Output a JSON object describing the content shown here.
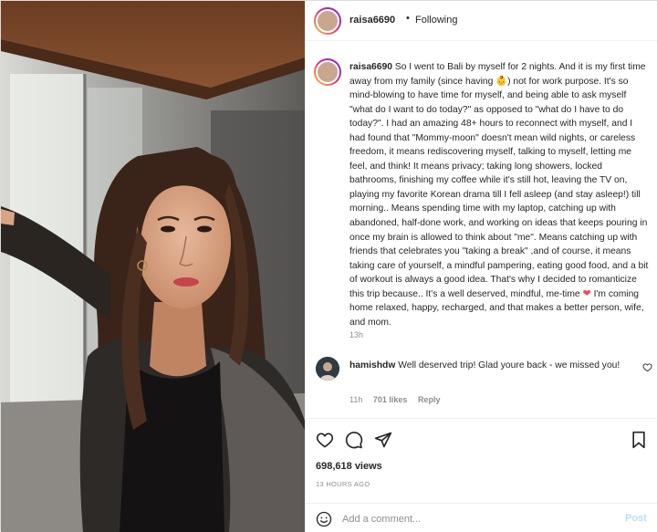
{
  "header": {
    "username": "raisa6690",
    "separator": "•",
    "follow_status": "Following"
  },
  "caption": {
    "username": "raisa6690",
    "text_part1": "So I went to Bali by myself for 2 nights. And it is my first time away from my family (since having ",
    "emoji_baby": "👶",
    "text_part2": ") not for work purpose. It's so mind-blowing to have time for myself, and being able to ask myself \"what do I want to do today?\" as opposed to \"what do I have to do today?\". I had an amazing 48+ hours to reconnect with myself, and I had found that \"Mommy-moon\" doesn't mean wild nights, or careless freedom, it means rediscovering myself, talking to myself, letting me feel, and think! It means privacy; taking long showers, locked bathrooms, finishing my coffee while it's still hot, leaving the TV on, playing my favorite Korean drama till I fell asleep (and stay asleep!) till morning.. Means spending time with my laptop, catching up with abandoned, half-done work, and working on ideas that keeps pouring in once my brain is allowed to think about \"me\". Means catching up with friends that celebrates you \"taking a break\" ,and of course, it means taking care of yourself, a mindful pampering, eating good food, and a bit of workout is always a good idea. That's why I decided to romanticize this trip because.. It's a well deserved, mindful, me-time ",
    "emoji_heart": "❤",
    "text_part3": " I'm coming home relaxed, happy, recharged, and that makes a better person, wife, and mom.",
    "time": "13h"
  },
  "comment": {
    "username": "hamishdw",
    "text": "Well deserved trip! Glad youre back - we missed you!",
    "time": "11h",
    "likes": "701 likes",
    "reply": "Reply"
  },
  "stats": {
    "views": "698,618 views",
    "posted": "13 HOURS AGO"
  },
  "add_comment": {
    "placeholder": "Add a comment...",
    "post_label": "Post"
  },
  "icons": {
    "like": "heart-outline",
    "comment": "speech-bubble",
    "share": "paper-plane",
    "save": "bookmark",
    "emoji": "smiley"
  },
  "colors": {
    "text": "#262626",
    "muted": "#8e8e8e",
    "heart": "#ed4956",
    "post_disabled": "#b2dffc",
    "border": "#efefef"
  }
}
